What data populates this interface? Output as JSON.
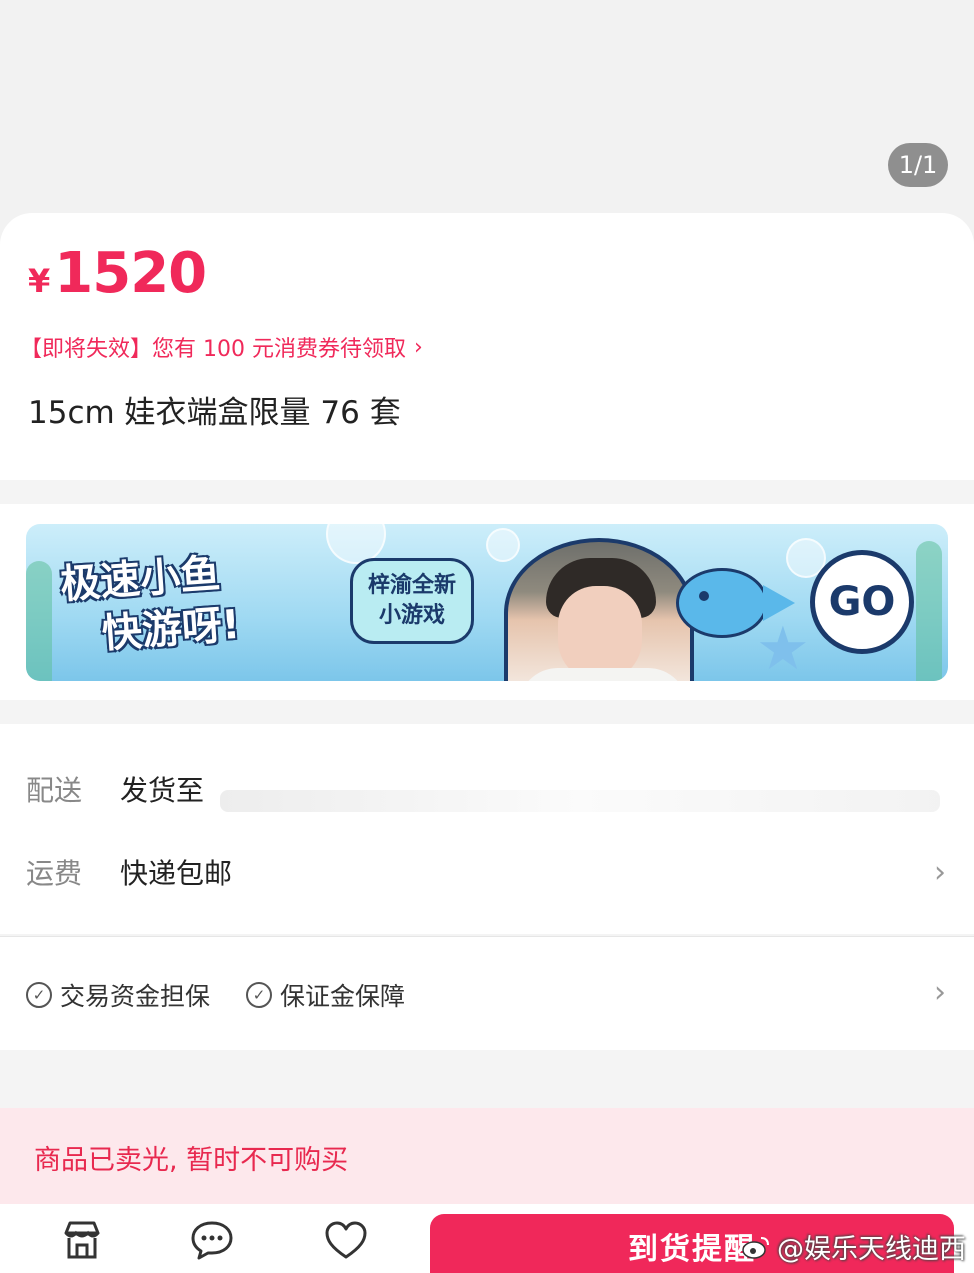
{
  "gallery": {
    "pager": "1/1"
  },
  "product": {
    "currency": "¥",
    "price": "1520",
    "coupon": "【即将失效】您有 100 元消费券待领取",
    "title": "15cm 娃衣端盒限量 76 套"
  },
  "banner": {
    "headline_line1": "极速小鱼",
    "headline_line2": "快游呀!",
    "tag_line1": "梓渝全新",
    "tag_line2": "小游戏",
    "go": "GO"
  },
  "shipping": {
    "delivery_key": "配送",
    "delivery_value": "发货至",
    "fee_key": "运费",
    "fee_value": "快递包邮"
  },
  "guarantees": [
    "交易资金担保",
    "保证金保障"
  ],
  "soldout_notice": "商品已卖光, 暂时不可购买",
  "bottom_bar": {
    "notify_label": "到货提醒"
  },
  "watermark": "@娱乐天线迪西",
  "colors": {
    "accent": "#f0295a",
    "soldout_bg": "#fde8ec"
  },
  "icons": [
    "shop-icon",
    "chat-icon",
    "heart-icon",
    "chevron-right-icon",
    "check-circle-icon",
    "weibo-logo-icon"
  ]
}
